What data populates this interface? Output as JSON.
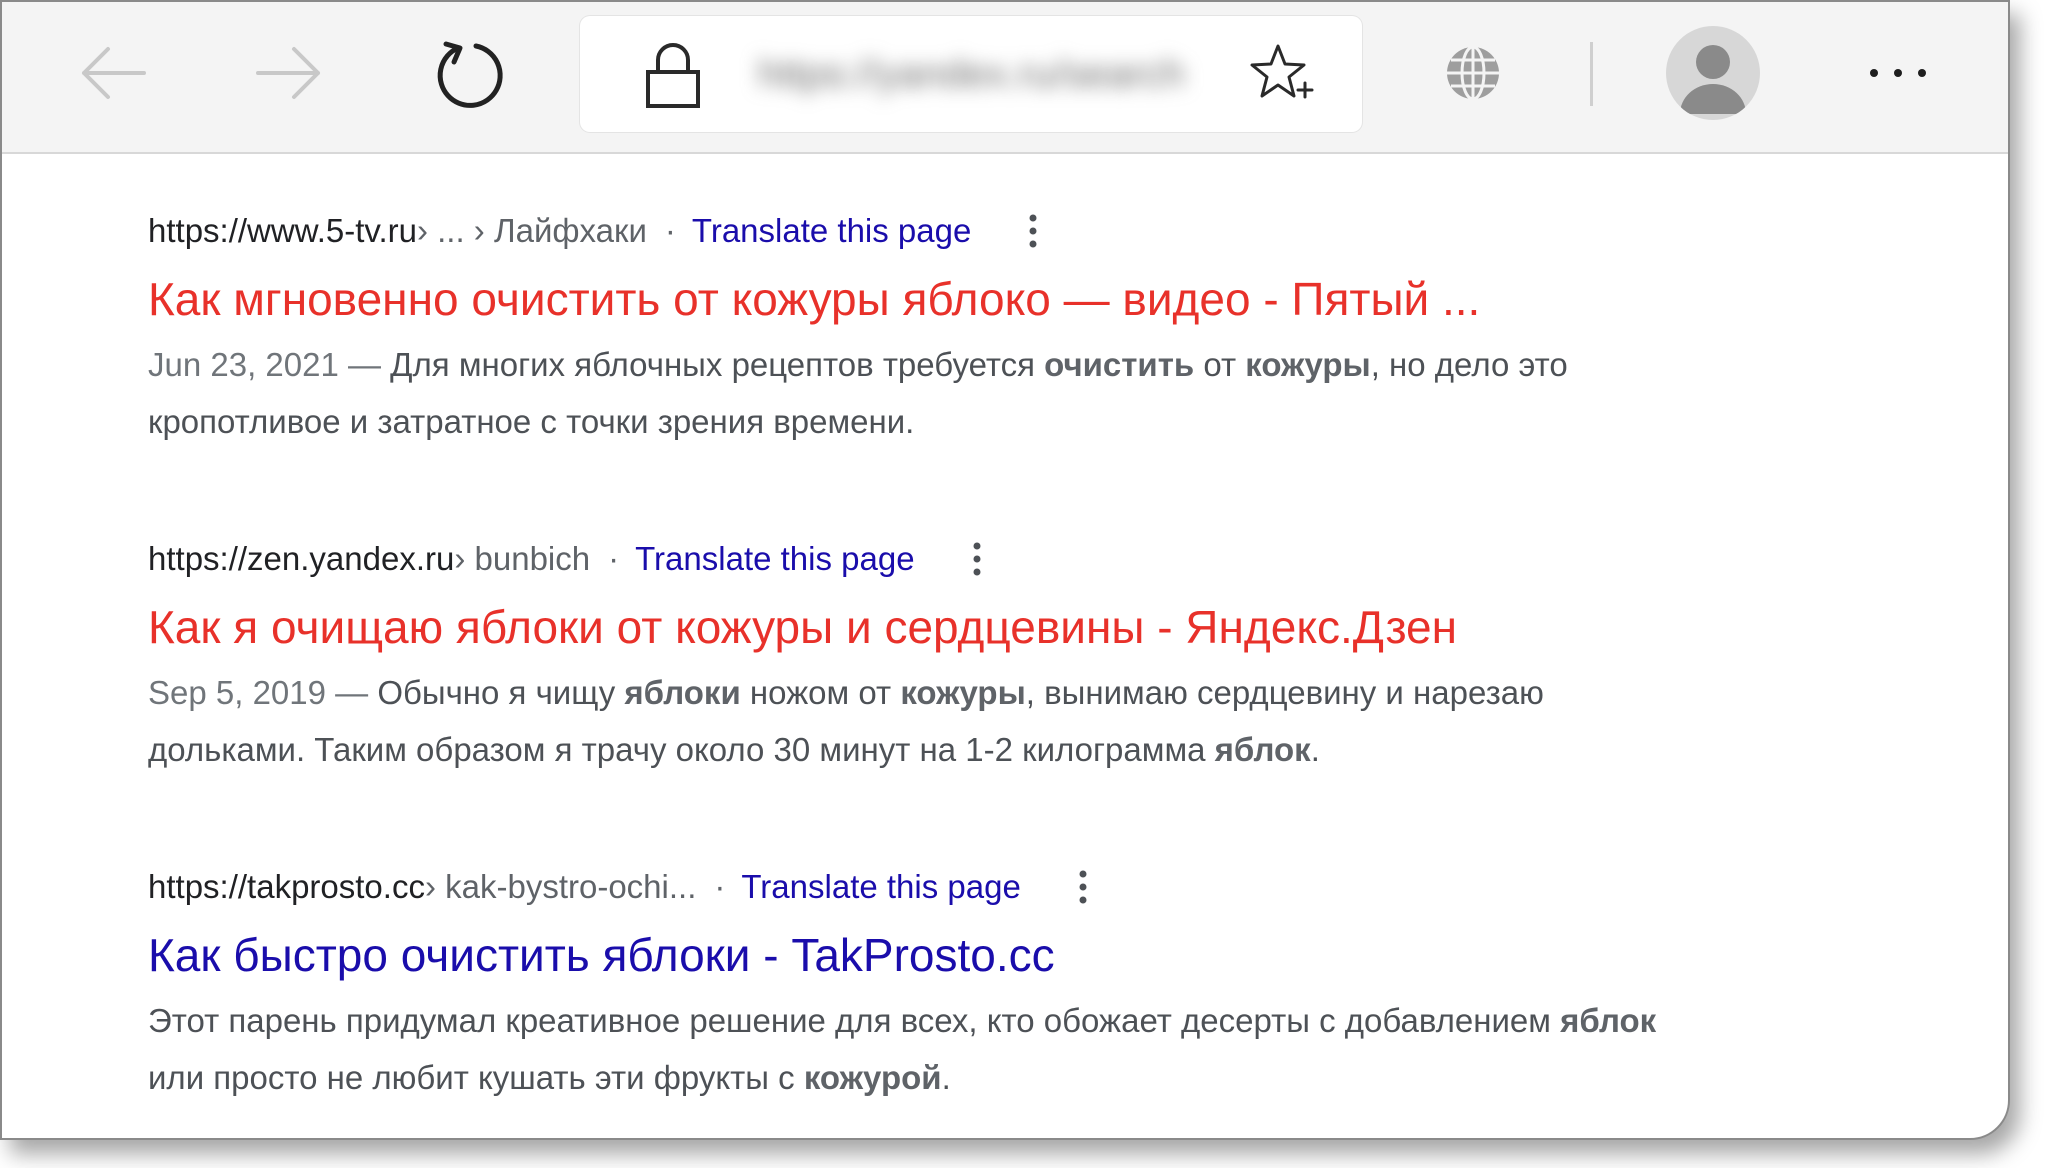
{
  "browser": {
    "icons": {
      "back": "arrow-left-icon",
      "forward": "arrow-right-icon",
      "reload": "reload-icon",
      "lock": "lock-icon",
      "favorite": "star-plus-icon",
      "globe": "globe-icon",
      "profile": "person-avatar-icon",
      "more": "ellipsis-icon"
    }
  },
  "results": [
    {
      "url": "https://www.5-tv.ru",
      "path": " › ... › Лайфхаки",
      "translate": "Translate this page",
      "title": "Как мгновенно очистить от кожуры яблоко — видео - Пятый ...",
      "title_color": "#e8312a",
      "date": "Jun 23, 2021 — ",
      "snippet_1": "Для многих яблочных рецептов требуется ",
      "snippet_b1": "очистить",
      "snippet_2": " от ",
      "snippet_b2": "кожуры",
      "snippet_3": ", но дело это кропотливое и затратное с точки зрения времени."
    },
    {
      "url": "https://zen.yandex.ru",
      "path": " › bunbich",
      "translate": "Translate this page",
      "title": "Как я очищаю яблоки от кожуры и сердцевины - Яндекс.Дзен",
      "title_color": "#e8312a",
      "date": "Sep 5, 2019 — ",
      "snippet_1": "Обычно я чищу ",
      "snippet_b1": "яблоки",
      "snippet_2": " ножом от ",
      "snippet_b2": "кожуры",
      "snippet_3": ", вынимаю сердцевину и нарезаю дольками. Таким образом я трачу около 30 минут на 1-2 килограмма ",
      "snippet_b3": "яблок",
      "snippet_4": "."
    },
    {
      "url": "https://takprosto.cc",
      "path": " › kak-bystro-ochi...",
      "translate": "Translate this page",
      "title": "Как быстро очистить яблоки - TakProsto.cc",
      "title_color": "#1a0dab",
      "snippet_1": "Этот парень придумал креативное решение для всех, кто обожает десерты с добавлением ",
      "snippet_b1": "яблок",
      "snippet_2": " или просто не любит кушать эти фрукты с ",
      "snippet_b2": "кожурой",
      "snippet_3": "."
    }
  ]
}
